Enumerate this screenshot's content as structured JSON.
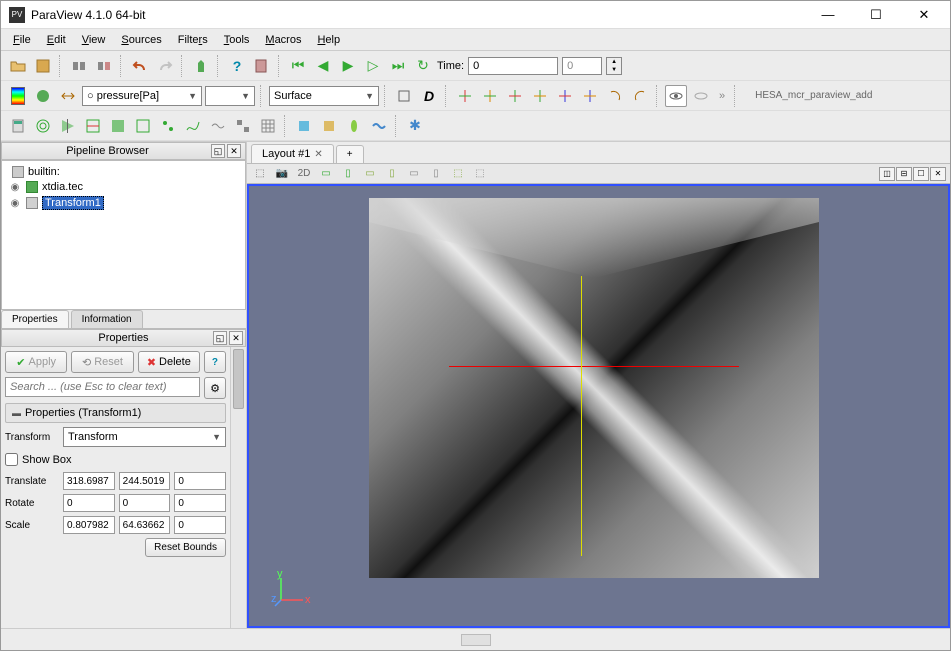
{
  "window": {
    "title": "ParaView 4.1.0 64-bit"
  },
  "menu": {
    "file": "File",
    "edit": "Edit",
    "view": "View",
    "sources": "Sources",
    "filters": "Filters",
    "tools": "Tools",
    "macros": "Macros",
    "help": "Help"
  },
  "toolbar": {
    "time_label": "Time:",
    "time_value": "0",
    "time_end": "0",
    "variable": "○ pressure[Pa]",
    "repr": "Surface",
    "right_text": "HESA_mcr_paraview_add"
  },
  "pipeline": {
    "title": "Pipeline Browser",
    "items": [
      {
        "label": "builtin:",
        "type": "server"
      },
      {
        "label": "xtdia.tec",
        "type": "src"
      },
      {
        "label": "Transform1",
        "type": "filter",
        "selected": true
      }
    ]
  },
  "props": {
    "tab_properties": "Properties",
    "tab_information": "Information",
    "header": "Properties",
    "apply": "Apply",
    "reset": "Reset",
    "delete": "Delete",
    "search_placeholder": "Search ... (use Esc to clear text)",
    "section": "Properties (Transform1)",
    "transform_label": "Transform",
    "transform_value": "Transform",
    "showbox": "Show Box",
    "translate_label": "Translate",
    "translate": [
      "318.6987",
      "244.5019",
      "0"
    ],
    "rotate_label": "Rotate",
    "rotate": [
      "0",
      "0",
      "0"
    ],
    "scale_label": "Scale",
    "scale": [
      "0.807982",
      "64.63662",
      "0"
    ],
    "reset_bounds": "Reset Bounds"
  },
  "layout": {
    "tab": "Layout #1",
    "toolbar_2d": "2D"
  },
  "axes_labels": {
    "x": "x",
    "y": "y",
    "z": "z"
  }
}
